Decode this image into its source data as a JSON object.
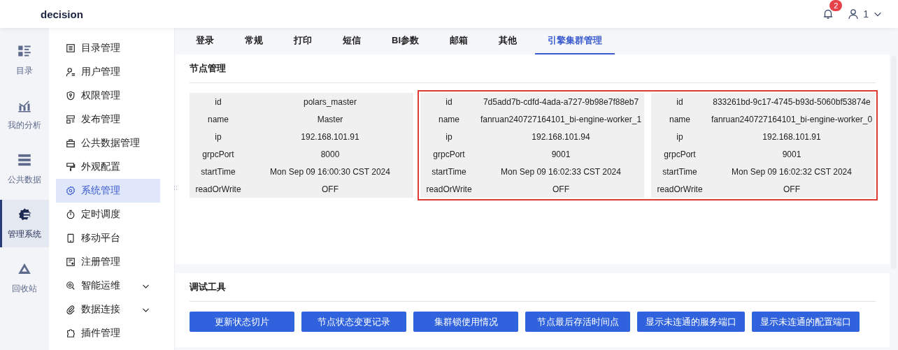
{
  "header": {
    "app_name": "decision",
    "notification_count": "2",
    "user_name": "1"
  },
  "rail": [
    {
      "label": "目录",
      "selected": false
    },
    {
      "label": "我的分析",
      "selected": false
    },
    {
      "label": "公共数据",
      "selected": false
    },
    {
      "label": "管理系统",
      "selected": true
    },
    {
      "label": "回收站",
      "selected": false
    }
  ],
  "menu": [
    {
      "label": "目录管理",
      "selected": false,
      "expandable": false
    },
    {
      "label": "用户管理",
      "selected": false,
      "expandable": false
    },
    {
      "label": "权限管理",
      "selected": false,
      "expandable": false
    },
    {
      "label": "发布管理",
      "selected": false,
      "expandable": false
    },
    {
      "label": "公共数据管理",
      "selected": false,
      "expandable": false
    },
    {
      "label": "外观配置",
      "selected": false,
      "expandable": false
    },
    {
      "label": "系统管理",
      "selected": true,
      "expandable": false
    },
    {
      "label": "定时调度",
      "selected": false,
      "expandable": false
    },
    {
      "label": "移动平台",
      "selected": false,
      "expandable": false
    },
    {
      "label": "注册管理",
      "selected": false,
      "expandable": false
    },
    {
      "label": "智能运维",
      "selected": false,
      "expandable": true
    },
    {
      "label": "数据连接",
      "selected": false,
      "expandable": true
    },
    {
      "label": "插件管理",
      "selected": false,
      "expandable": false
    }
  ],
  "tabs": [
    {
      "label": "登录",
      "selected": false
    },
    {
      "label": "常规",
      "selected": false
    },
    {
      "label": "打印",
      "selected": false
    },
    {
      "label": "短信",
      "selected": false
    },
    {
      "label": "BI参数",
      "selected": false
    },
    {
      "label": "邮箱",
      "selected": false
    },
    {
      "label": "其他",
      "selected": false
    },
    {
      "label": "引擎集群管理",
      "selected": true
    }
  ],
  "node_section": {
    "title": "节点管理",
    "node_groups": [
      {
        "highlighted": false,
        "nodes": [
          {
            "fields": [
              {
                "key": "id",
                "value": "polars_master"
              },
              {
                "key": "name",
                "value": "Master"
              },
              {
                "key": "ip",
                "value": "192.168.101.91"
              },
              {
                "key": "grpcPort",
                "value": "8000"
              },
              {
                "key": "startTime",
                "value": "Mon Sep 09 16:00:30 CST 2024"
              },
              {
                "key": "readOrWrite",
                "value": "OFF"
              }
            ]
          }
        ]
      },
      {
        "highlighted": true,
        "nodes": [
          {
            "fields": [
              {
                "key": "id",
                "value": "7d5add7b-cdfd-4ada-a727-9b98e7f88eb7"
              },
              {
                "key": "name",
                "value": "fanruan240727164101_bi-engine-worker_1"
              },
              {
                "key": "ip",
                "value": "192.168.101.94"
              },
              {
                "key": "grpcPort",
                "value": "9001"
              },
              {
                "key": "startTime",
                "value": "Mon Sep 09 16:02:33 CST 2024"
              },
              {
                "key": "readOrWrite",
                "value": "OFF"
              }
            ]
          },
          {
            "fields": [
              {
                "key": "id",
                "value": "833261bd-9c17-4745-b93d-5060bf53874e"
              },
              {
                "key": "name",
                "value": "fanruan240727164101_bi-engine-worker_0"
              },
              {
                "key": "ip",
                "value": "192.168.101.91"
              },
              {
                "key": "grpcPort",
                "value": "9001"
              },
              {
                "key": "startTime",
                "value": "Mon Sep 09 16:02:32 CST 2024"
              },
              {
                "key": "readOrWrite",
                "value": "OFF"
              }
            ]
          }
        ]
      }
    ]
  },
  "debug_tools": {
    "title": "调试工具",
    "buttons": [
      "更新状态切片",
      "节点状态变更记录",
      "集群锁使用情况",
      "节点最后存活时间点",
      "显示未连通的服务端口",
      "显示未连通的配置端口"
    ]
  }
}
